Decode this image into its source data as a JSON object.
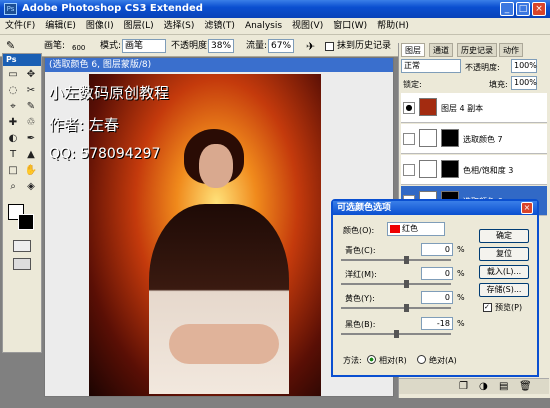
{
  "app": {
    "title": "Adobe Photoshop CS3 Extended",
    "icon_label": "Ps"
  },
  "window_buttons": {
    "minimize": "_",
    "maximize": "□",
    "close": "×"
  },
  "menus": [
    "文件(F)",
    "编辑(E)",
    "图像(I)",
    "图层(L)",
    "选择(S)",
    "滤镜(T)",
    "Analysis",
    "视图(V)",
    "窗口(W)",
    "帮助(H)"
  ],
  "options": {
    "brush_label": "画笔:",
    "brush_size": "600",
    "mode_label": "模式:",
    "mode_value": "画笔",
    "opacity_label": "不透明度:",
    "opacity_value": "38%",
    "flow_label": "流量:",
    "flow_value": "67%",
    "erase_history": "抹到历史记录"
  },
  "toolbox": {
    "header": "Ps",
    "tools": [
      "▭",
      "✥",
      "◌",
      "✂",
      "⌖",
      "✎",
      "✚",
      "♲",
      "◐",
      "✒",
      "T",
      "▲",
      "□",
      "✋",
      "⌕",
      "◈"
    ]
  },
  "document": {
    "title": "(选取颜色 6, 图层蒙版/8)",
    "overlay_line1": "小左数码原创教程",
    "overlay_line2": "作者: 左春",
    "overlay_line3": "QQ: 578094297"
  },
  "panels": {
    "tabs": [
      "图层",
      "通道",
      "历史记录",
      "动作"
    ],
    "blend_mode": "正常",
    "opacity_label": "不透明度:",
    "opacity_value": "100%",
    "lock_label": "锁定:",
    "fill_label": "填充:",
    "fill_value": "100%"
  },
  "layers": [
    {
      "name": "图层 4 副本",
      "active": false
    },
    {
      "name": "选取颜色 7",
      "active": false
    },
    {
      "name": "色相/饱和度 3",
      "active": false
    },
    {
      "name": "选取颜色 6",
      "active": true
    }
  ],
  "dialog": {
    "title": "可选颜色选项",
    "colors_label": "颜色(O):",
    "colors_value": "红色",
    "buttons": {
      "ok": "确定",
      "reset": "复位",
      "load": "载入(L)...",
      "save": "存储(S)...",
      "preview": "预览(P)"
    },
    "sliders": [
      {
        "label": "青色(C):",
        "value": "0",
        "pct": "%"
      },
      {
        "label": "洋红(M):",
        "value": "0",
        "pct": "%"
      },
      {
        "label": "黄色(Y):",
        "value": "0",
        "pct": "%"
      },
      {
        "label": "黑色(B):",
        "value": "-18",
        "pct": "%"
      }
    ],
    "method_label": "方法:",
    "method_relative": "相对(R)",
    "method_absolute": "绝对(A)"
  }
}
